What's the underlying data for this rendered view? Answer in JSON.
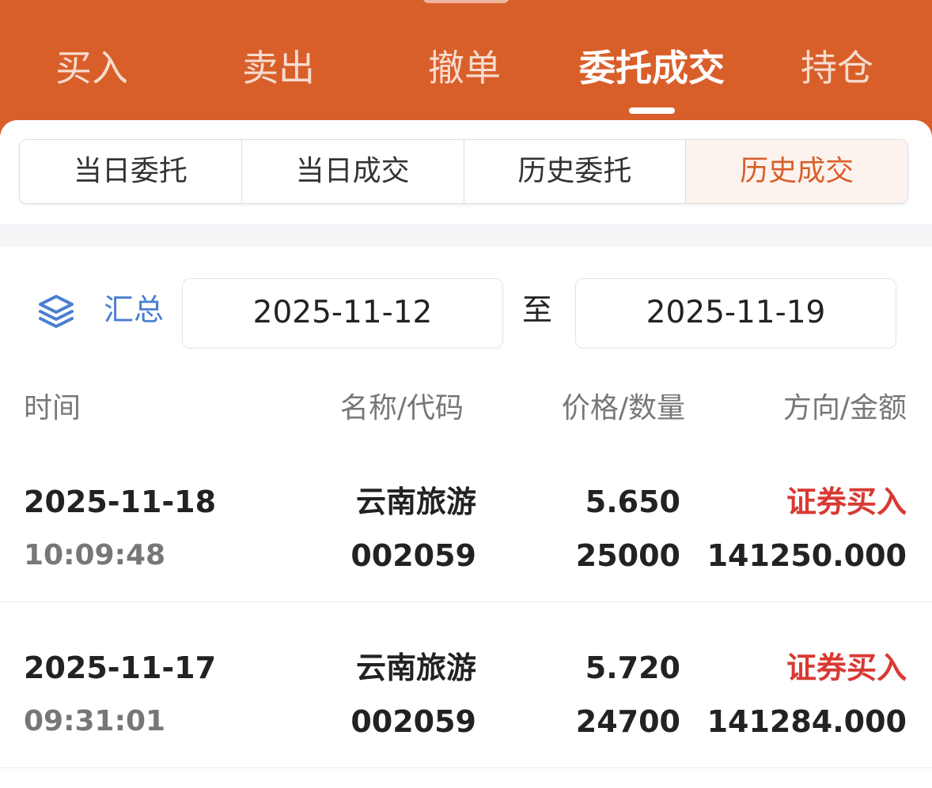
{
  "theme": {
    "brand": "#D95F2A",
    "accent_blue": "#4A7FD0",
    "buy_red": "#D83A33"
  },
  "header": {
    "tabs": [
      {
        "label": "买入"
      },
      {
        "label": "卖出"
      },
      {
        "label": "撤单"
      },
      {
        "label": "委托成交"
      },
      {
        "label": "持仓"
      }
    ],
    "active_tab": 3
  },
  "subtabs": [
    {
      "label": "当日委托"
    },
    {
      "label": "当日成交"
    },
    {
      "label": "历史委托"
    },
    {
      "label": "历史成交"
    }
  ],
  "active_subtab": 3,
  "filter": {
    "summary_icon": "layers-icon",
    "summary_label": "汇总",
    "start_date": "2025-11-12",
    "to_label": "至",
    "end_date": "2025-11-19"
  },
  "columns": {
    "time": "时间",
    "name_code": "名称/代码",
    "price_qty": "价格/数量",
    "dir_amount": "方向/金额"
  },
  "rows": [
    {
      "date": "2025-11-18",
      "time": "10:09:48",
      "name": "云南旅游",
      "code": "002059",
      "price": "5.650",
      "quantity": "25000",
      "direction": "证券买入",
      "amount": "141250.000"
    },
    {
      "date": "2025-11-17",
      "time": "09:31:01",
      "name": "云南旅游",
      "code": "002059",
      "price": "5.720",
      "quantity": "24700",
      "direction": "证券买入",
      "amount": "141284.000"
    }
  ]
}
